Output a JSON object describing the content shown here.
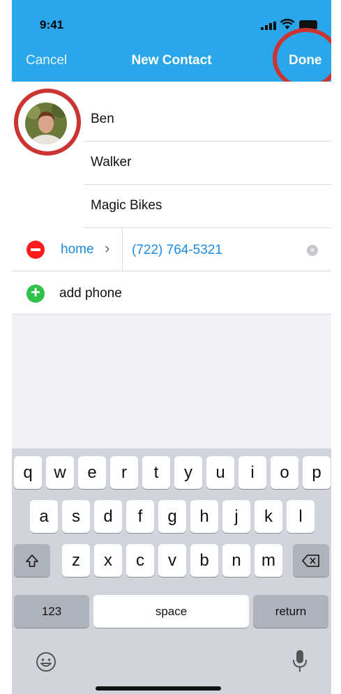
{
  "status_bar": {
    "time": "9:41"
  },
  "nav": {
    "cancel": "Cancel",
    "title": "New Contact",
    "done": "Done"
  },
  "contact": {
    "first_name": "Ben",
    "last_name": "Walker",
    "company": "Magic Bikes",
    "phone_label": "home",
    "phone_number": "(722) 764-5321",
    "add_phone": "add phone"
  },
  "keyboard": {
    "row1": [
      "q",
      "w",
      "e",
      "r",
      "t",
      "y",
      "u",
      "i",
      "o",
      "p"
    ],
    "row2": [
      "a",
      "s",
      "d",
      "f",
      "g",
      "h",
      "j",
      "k",
      "l"
    ],
    "row3": [
      "z",
      "x",
      "c",
      "v",
      "b",
      "n",
      "m"
    ],
    "numbers": "123",
    "space": "space",
    "return": "return"
  },
  "colors": {
    "header": "#2aa7ea",
    "link": "#1a8be0",
    "delete": "#ff1c1c",
    "add": "#2fc24a",
    "highlight": "#cc3333"
  },
  "icons": [
    "signal-icon",
    "wifi-icon",
    "battery-icon",
    "chevron-right-icon",
    "clear-icon",
    "shift-icon",
    "backspace-icon",
    "emoji-icon",
    "microphone-icon"
  ]
}
